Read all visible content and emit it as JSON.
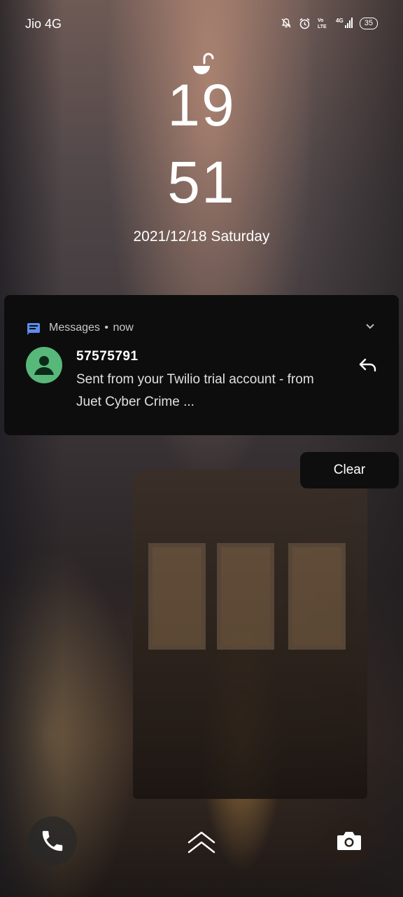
{
  "status_bar": {
    "carrier": "Jio 4G",
    "battery": "35",
    "icons": [
      "mute-bell-icon",
      "alarm-icon",
      "volte-icon",
      "signal-4g-icon",
      "battery-icon"
    ]
  },
  "lockscreen": {
    "hour": "19",
    "minute": "51",
    "date": "2021/12/18  Saturday"
  },
  "notification": {
    "app_name": "Messages",
    "separator": "•",
    "time": "now",
    "sender": "57575791",
    "line1": "Sent from your Twilio trial account - from",
    "line2": "Juet Cyber Crime ...",
    "avatar_color": "#57b87a",
    "app_icon_color": "#5b8def"
  },
  "actions": {
    "clear_label": "Clear"
  },
  "bottom": {
    "left_icon": "phone-icon",
    "center_icon": "swipe-up-icon",
    "right_icon": "camera-icon"
  }
}
